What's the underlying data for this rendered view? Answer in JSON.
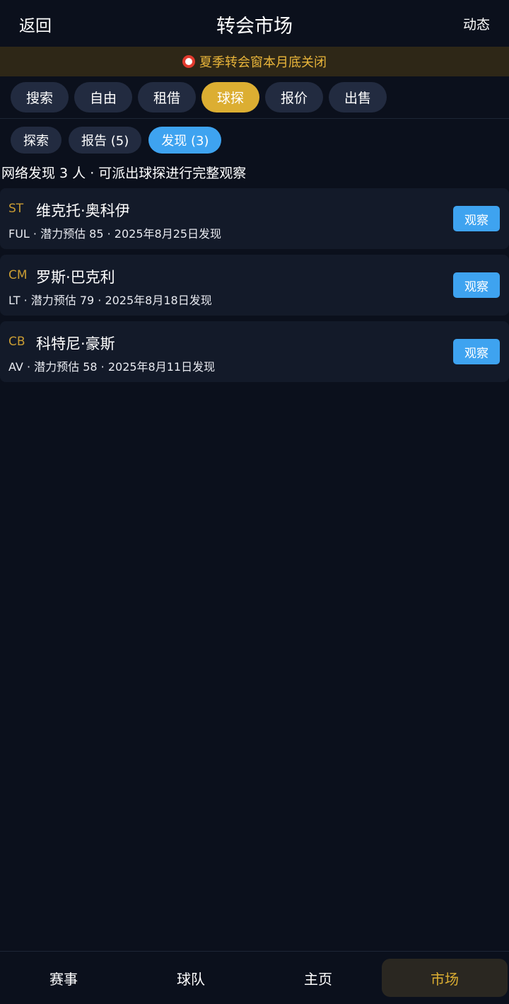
{
  "header": {
    "back_label": "返回",
    "title": "转会市场",
    "feed_label": "动态"
  },
  "banner": {
    "icon": "alarm-clock-icon",
    "text": "夏季转会窗本月底关闭"
  },
  "main_tabs": [
    {
      "label": "搜索"
    },
    {
      "label": "自由"
    },
    {
      "label": "租借"
    },
    {
      "label": "球探",
      "active": true
    },
    {
      "label": "报价"
    },
    {
      "label": "出售"
    }
  ],
  "sub_tabs": [
    {
      "label": "探索"
    },
    {
      "label": "报告 (5)"
    },
    {
      "label": "发现 (3)",
      "active": true
    }
  ],
  "info_text": "网络发现 3 人 · 可派出球探进行完整观察",
  "players": [
    {
      "position": "ST",
      "name": "维克托·奥科伊",
      "meta": "FUL · 潜力预估 85 · 2025年8月25日发现",
      "action": "观察"
    },
    {
      "position": "CM",
      "name": "罗斯·巴克利",
      "meta": "LT · 潜力预估 79 · 2025年8月18日发现",
      "action": "观察"
    },
    {
      "position": "CB",
      "name": "科特尼·豪斯",
      "meta": "AV · 潜力预估 58 · 2025年8月11日发现",
      "action": "观察"
    }
  ],
  "bottom_nav": [
    {
      "label": "赛事"
    },
    {
      "label": "球队"
    },
    {
      "label": "主页"
    },
    {
      "label": "市场",
      "active": true
    }
  ],
  "colors": {
    "background": "#0b101c",
    "accent_gold": "#dcae32",
    "accent_blue": "#3ea3f0",
    "card": "#131a29"
  }
}
